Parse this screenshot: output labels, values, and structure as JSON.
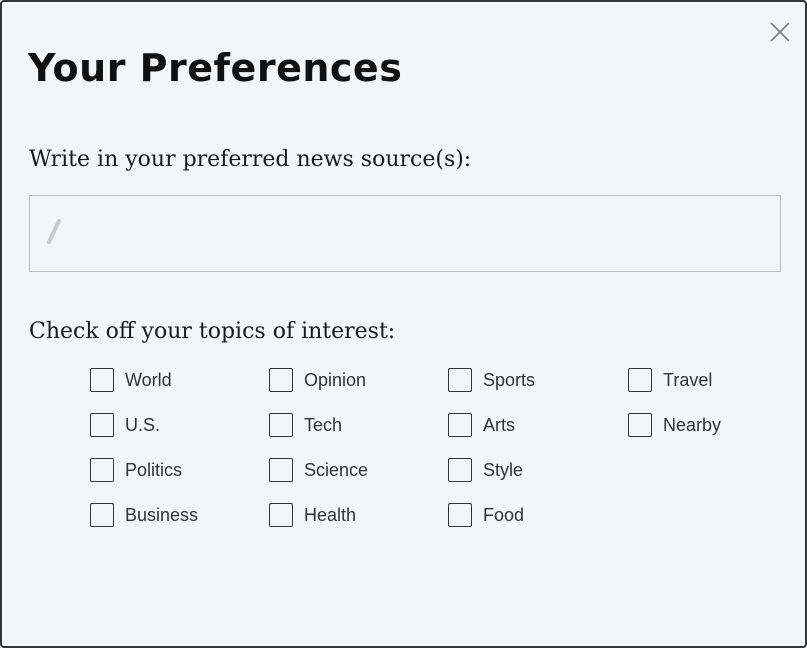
{
  "dialog": {
    "title": "Your Preferences",
    "close_icon": "close-icon"
  },
  "source": {
    "label": "Write in your preferred news source(s):",
    "value": "",
    "placeholder": "",
    "icon": "pencil-icon"
  },
  "topics": {
    "label": "Check off your topics of interest:",
    "items": [
      {
        "id": "world",
        "label": "World",
        "checked": false
      },
      {
        "id": "opinion",
        "label": "Opinion",
        "checked": false
      },
      {
        "id": "sports",
        "label": "Sports",
        "checked": false
      },
      {
        "id": "travel",
        "label": "Travel",
        "checked": false
      },
      {
        "id": "us",
        "label": "U.S.",
        "checked": false
      },
      {
        "id": "tech",
        "label": "Tech",
        "checked": false
      },
      {
        "id": "arts",
        "label": "Arts",
        "checked": false
      },
      {
        "id": "nearby",
        "label": "Nearby",
        "checked": false
      },
      {
        "id": "politics",
        "label": "Politics",
        "checked": false
      },
      {
        "id": "science",
        "label": "Science",
        "checked": false
      },
      {
        "id": "style",
        "label": "Style",
        "checked": false
      },
      {
        "id": "business",
        "label": "Business",
        "checked": false
      },
      {
        "id": "health",
        "label": "Health",
        "checked": false
      },
      {
        "id": "food",
        "label": "Food",
        "checked": false
      }
    ]
  },
  "colors": {
    "background": "#f4f5f7",
    "border": "#333538",
    "text": "#1a1a1a",
    "input_border": "#b9bcc0"
  }
}
